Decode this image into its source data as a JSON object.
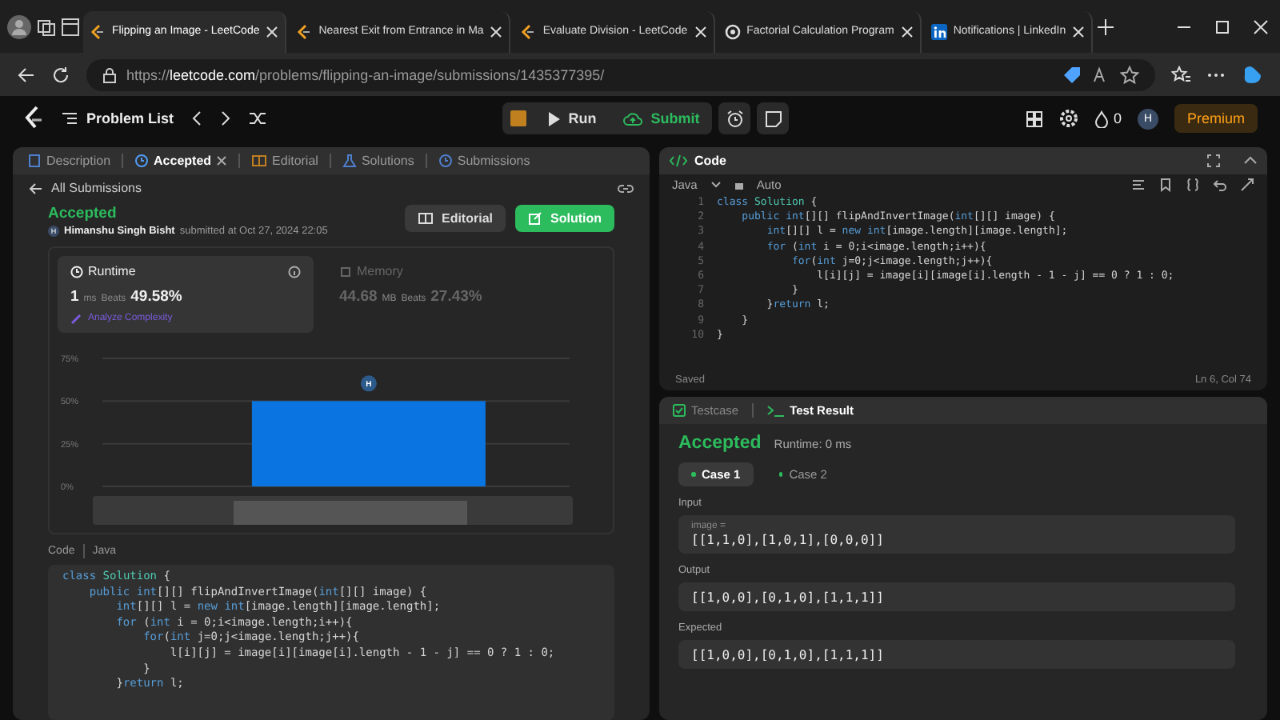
{
  "browser": {
    "tabs": [
      {
        "title": "Flipping an Image - LeetCode",
        "selected": true,
        "kind": "leetcode"
      },
      {
        "title": "Nearest Exit from Entrance in Ma",
        "selected": false,
        "kind": "leetcode"
      },
      {
        "title": "Evaluate Division - LeetCode",
        "selected": false,
        "kind": "leetcode"
      },
      {
        "title": "Factorial Calculation Program",
        "selected": false,
        "kind": "chat"
      },
      {
        "title": "Notifications | LinkedIn",
        "selected": false,
        "kind": "linkedin"
      }
    ],
    "url_scheme": "https://",
    "url_host": "leetcode.com",
    "url_path": "/problems/flipping-an-image/submissions/1435377395/"
  },
  "toolbar": {
    "problem_list": "Problem List",
    "run": "Run",
    "submit": "Submit",
    "streak": "0",
    "avatar": "H",
    "premium": "Premium"
  },
  "left_panel": {
    "tabs": [
      {
        "label": "Description",
        "selected": false,
        "closable": false,
        "kind": "doc"
      },
      {
        "label": "Accepted",
        "selected": true,
        "closable": true,
        "kind": "history"
      },
      {
        "label": "Editorial",
        "selected": false,
        "closable": false,
        "kind": "book"
      },
      {
        "label": "Solutions",
        "selected": false,
        "closable": false,
        "kind": "flask"
      },
      {
        "label": "Submissions",
        "selected": false,
        "closable": false,
        "kind": "history"
      }
    ],
    "back": "All Submissions",
    "status": "Accepted",
    "author_avatar": "H",
    "author": "Himanshu Singh Bisht",
    "submitted": "submitted at Oct 27, 2024 22:05",
    "buttons": [
      {
        "label": "Editorial",
        "kind": "secondary"
      },
      {
        "label": "Solution",
        "kind": "primary"
      }
    ],
    "stats": [
      {
        "label": "Runtime",
        "value": "1",
        "unit": "ms",
        "beats_label": "Beats",
        "beats": "49.58%",
        "selected": true,
        "kind": "clock"
      },
      {
        "label": "Memory",
        "value": "44.68",
        "unit": "MB",
        "beats_label": "Beats",
        "beats": "27.43%",
        "selected": false,
        "kind": "chip"
      }
    ],
    "analyze": "Analyze Complexity",
    "chart": {
      "marker": "H",
      "chart_data": {
        "type": "bar",
        "values": [
          50
        ],
        "ylim": [
          0,
          75
        ],
        "yticks": [
          {
            "value": 0,
            "label": "0%"
          },
          {
            "value": 25,
            "label": "25%"
          },
          {
            "value": 50,
            "label": "50%"
          },
          {
            "value": 75,
            "label": "75%"
          }
        ]
      }
    },
    "code_label": "Code",
    "code_lang": "Java",
    "code_lines": [
      "class Solution {",
      "    public int[][] flipAndInvertImage(int[][] image) {",
      "        int[][] l = new int[image.length][image.length];",
      "        for (int i = 0;i<image.length;i++){",
      "            for(int j=0;j<image.length;j++){",
      "                l[i][j] = image[i][image[i].length - 1 - j] == 0 ? 1 : 0;",
      "            }",
      "        }return l;"
    ]
  },
  "code_panel": {
    "title": "Code",
    "language": "Java",
    "mode": "Auto",
    "lines": [
      "class Solution {",
      "    public int[][] flipAndInvertImage(int[][] image) {",
      "        int[][] l = new int[image.length][image.length];",
      "        for (int i = 0;i<image.length;i++){",
      "            for(int j=0;j<image.length;j++){",
      "                l[i][j] = image[i][image[i].length - 1 - j] == 0 ? 1 : 0;",
      "            }",
      "        }return l;",
      "    }",
      "}"
    ],
    "line_numbers": [
      "1",
      "2",
      "3",
      "4",
      "5",
      "6",
      "7",
      "8",
      "9",
      "10"
    ],
    "status": "Saved",
    "cursor": "Ln 6, Col 74"
  },
  "result_panel": {
    "tabs": [
      {
        "label": "Testcase",
        "selected": false,
        "kind": "check"
      },
      {
        "label": "Test Result",
        "selected": true,
        "kind": "terminal"
      }
    ],
    "status": "Accepted",
    "runtime": "Runtime: 0 ms",
    "cases": [
      {
        "label": "Case 1",
        "selected": true
      },
      {
        "label": "Case 2",
        "selected": false
      }
    ],
    "input_label": "Input",
    "input_var": "image =",
    "input_value": "[[1,1,0],[1,0,1],[0,0,0]]",
    "output_label": "Output",
    "output_value": "[[1,0,0],[0,1,0],[1,1,1]]",
    "expected_label": "Expected",
    "expected_value": "[[1,0,0],[0,1,0],[1,1,1]]"
  }
}
